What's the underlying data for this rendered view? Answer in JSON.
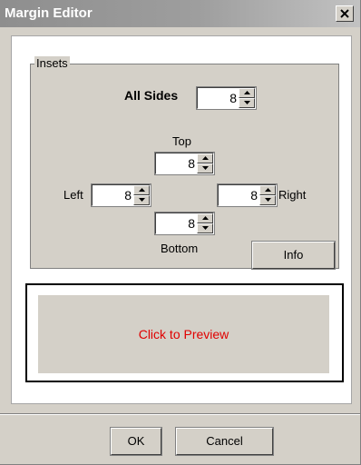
{
  "window": {
    "title": "Margin Editor",
    "close_icon": "close-icon"
  },
  "insets": {
    "legend": "Insets",
    "all_sides": {
      "label": "All Sides",
      "value": "8"
    },
    "top": {
      "label": "Top",
      "value": "8"
    },
    "left": {
      "label": "Left",
      "value": "8"
    },
    "right": {
      "label": "Right",
      "value": "8"
    },
    "bottom": {
      "label": "Bottom",
      "value": "8"
    },
    "info_label": "Info"
  },
  "preview": {
    "text": "Click to Preview",
    "text_color": "#e00000"
  },
  "footer": {
    "ok_label": "OK",
    "cancel_label": "Cancel"
  }
}
